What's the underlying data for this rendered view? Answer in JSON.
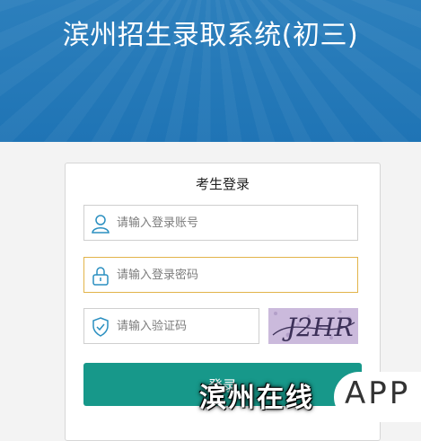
{
  "header": {
    "title": "滨州招生录取系统(初三)"
  },
  "login": {
    "title": "考生登录",
    "account_placeholder": "请输入登录账号",
    "password_placeholder": "请输入登录密码",
    "captcha_placeholder": "请输入验证码",
    "captcha_text": "J2HR",
    "submit_label": "登录"
  },
  "watermark": {
    "name": "滨州在线",
    "app": "APP"
  },
  "colors": {
    "banner": "#1f74b5",
    "button": "#17988a",
    "active_border": "#e2b44a",
    "icon": "#2a8fc0"
  }
}
